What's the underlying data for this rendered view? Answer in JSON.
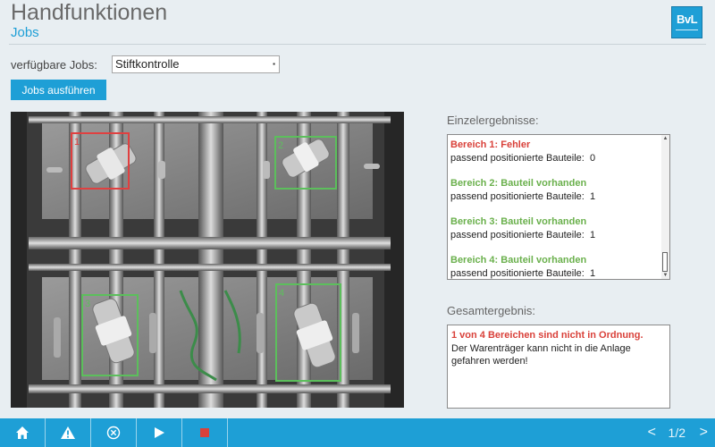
{
  "header": {
    "title": "Handfunktionen",
    "subtitle": "Jobs",
    "logo_text": "BvL"
  },
  "jobs": {
    "label": "verfügbare Jobs:",
    "selected": "Stiftkontrolle",
    "run_button": "Jobs ausführen"
  },
  "camera": {
    "regions": [
      {
        "label": "1",
        "status": "error"
      },
      {
        "label": "2",
        "status": "ok"
      },
      {
        "label": "3",
        "status": "ok"
      },
      {
        "label": "4",
        "status": "ok"
      }
    ]
  },
  "results": {
    "label": "Einzelergebnisse:",
    "items": [
      {
        "title": "Bereich 1: Fehler",
        "status": "error",
        "detail_label": "passend positionierte Bauteile:",
        "detail_value": "0"
      },
      {
        "title": "Bereich 2: Bauteil vorhanden",
        "status": "ok",
        "detail_label": "passend positionierte Bauteile:",
        "detail_value": "1"
      },
      {
        "title": "Bereich 3: Bauteil vorhanden",
        "status": "ok",
        "detail_label": "passend positionierte Bauteile:",
        "detail_value": "1"
      },
      {
        "title": "Bereich 4: Bauteil vorhanden",
        "status": "ok",
        "detail_label": "passend positionierte Bauteile:",
        "detail_value": "1"
      }
    ]
  },
  "overall": {
    "label": "Gesamtergebnis:",
    "title": "1 von 4 Bereichen sind nicht in Ordnung.",
    "text": "Der Warenträger kann nicht in die Anlage gefahren werden!"
  },
  "footer": {
    "buttons": [
      "home-icon",
      "warning-icon",
      "cancel-icon",
      "play-icon",
      "stop-icon"
    ],
    "page": "1/2",
    "prev": "<",
    "next": ">"
  },
  "colors": {
    "accent": "#1e9fd6",
    "error": "#d9413a",
    "ok": "#6ab04c",
    "stop": "#d9413a"
  }
}
